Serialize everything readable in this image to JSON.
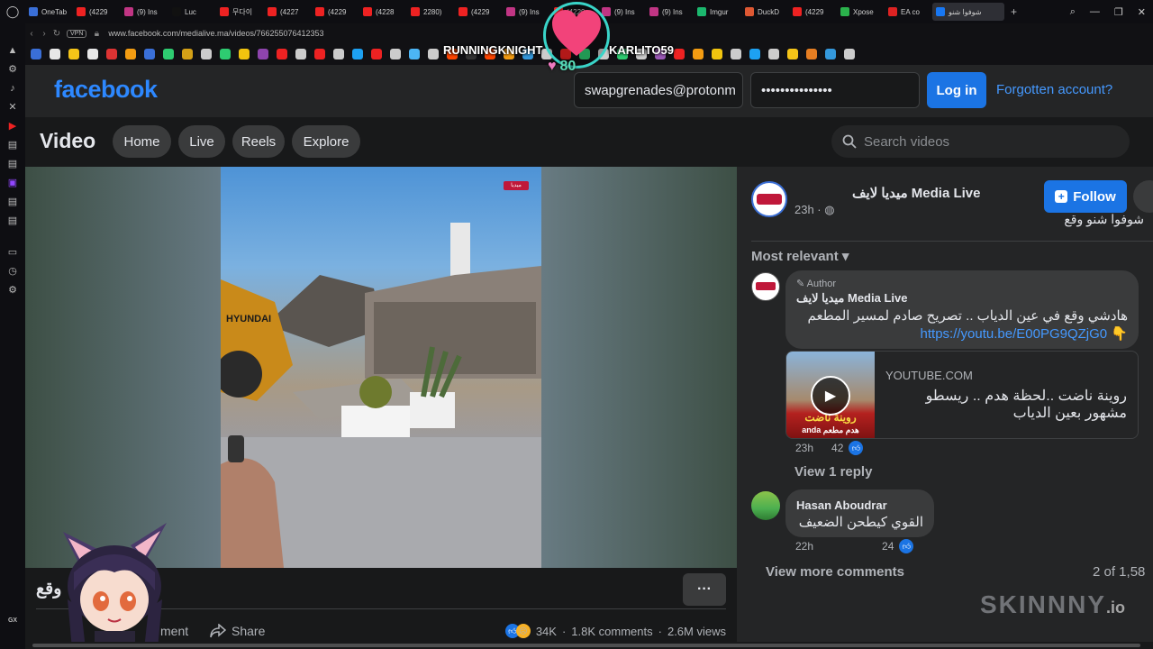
{
  "browser": {
    "tabs": [
      {
        "label": "OneTab",
        "color": "#3a6fd8"
      },
      {
        "label": "(4229",
        "color": "#e22"
      },
      {
        "label": "(9) Ins",
        "color": "#c13584"
      },
      {
        "label": "Luc",
        "color": "#111"
      },
      {
        "label": "무다이",
        "color": "#e22"
      },
      {
        "label": "(4227",
        "color": "#e22"
      },
      {
        "label": "(4229",
        "color": "#e22"
      },
      {
        "label": "(4228",
        "color": "#e22"
      },
      {
        "label": "2280)",
        "color": "#e22"
      },
      {
        "label": "(4229",
        "color": "#e22"
      },
      {
        "label": "(9) Ins",
        "color": "#c13584"
      },
      {
        "label": "(4229",
        "color": "#e22"
      },
      {
        "label": "(9) Ins",
        "color": "#c13584"
      },
      {
        "label": "(9) Ins",
        "color": "#c13584"
      },
      {
        "label": "Imgur",
        "color": "#1bb76e"
      },
      {
        "label": "DuckD",
        "color": "#de5833"
      },
      {
        "label": "(4229",
        "color": "#e22"
      },
      {
        "label": "Xpose",
        "color": "#2bb24c"
      },
      {
        "label": "EA co",
        "color": "#d22"
      },
      {
        "label": "شوفوا شنو",
        "color": "#1877f2",
        "active": true
      }
    ],
    "url": "www.facebook.com/medialive.ma/videos/766255076412353",
    "vpn_label": "VPN",
    "new_tab": "+"
  },
  "bookmark_colors": [
    "#3a6fd8",
    "#e7e7e7",
    "#f5c518",
    "#e7e7e7",
    "#d33",
    "#f39c12",
    "#3a6fd8",
    "#2ecc71",
    "#d4a017",
    "#ccc",
    "#2ecc71",
    "#f1c40f",
    "#8e44ad",
    "#e22",
    "#ccc",
    "#e22",
    "#ccc",
    "#1da1f2",
    "#e22",
    "#ccc",
    "#4cb5f5",
    "#ccc",
    "#ff4500",
    "#333",
    "#ff4500",
    "#f39c12",
    "#3498db",
    "#ccc",
    "#e22",
    "#2ecc71",
    "#ccc",
    "#2ecc71",
    "#ccc",
    "#9b59b6",
    "#e22",
    "#f39c12",
    "#f1c40f",
    "#ccc",
    "#1da1f2",
    "#ccc",
    "#f5c518",
    "#e67e22",
    "#3498db",
    "#ccc"
  ],
  "header": {
    "logo": "facebook",
    "email_value": "swapgrenades@protonm",
    "password_value": "•••••••••••••••",
    "login_label": "Log in",
    "forgot_label": "Forgotten account?"
  },
  "video_nav": {
    "title": "Video",
    "tabs": [
      "Home",
      "Live",
      "Reels",
      "Explore"
    ],
    "search_placeholder": "Search videos"
  },
  "video": {
    "watermark": "ميديا",
    "caption": "وقع",
    "actions": [
      "ment",
      "Share"
    ],
    "reaction_count": "34K",
    "comments": "1.8K comments",
    "views": "2.6M views",
    "separator": "·"
  },
  "post": {
    "page_name": "ميديا لايف Media Live",
    "time": "23h ·",
    "follow_label": "Follow",
    "text": "شوفوا شنو وقع",
    "sort_label": "Most relevant",
    "comments": [
      {
        "author_tag": "Author",
        "name": "ميديا لايف Media Live",
        "text": "هادشي وقع في عين الدياب .. تصريح صادم لمسير المطعم",
        "link": "https://youtu.be/E00PG9QZjG0 👇",
        "time": "23h",
        "likes": "42"
      },
      {
        "name": "Hasan Aboudrar",
        "text": "القوي كيطحن الضعيف",
        "time": "22h",
        "likes": "24"
      }
    ],
    "link_card": {
      "domain": "YOUTUBE.COM",
      "title": "روينة ناضت ..لحظة هدم .. ريسطو مشهور بعين الدياب",
      "thumb_text": "روينة ناضت",
      "thumb_sub": "anda هدم مطعم"
    },
    "view_reply": "View 1 reply",
    "view_more": "View more comments",
    "count": "2 of 1,58"
  },
  "overlays": {
    "left_name": "RUNNINGKNIGHT",
    "right_name": "KARLITO59",
    "heart_count": "80",
    "brand": "SKINNNY",
    "brand_suffix": ".io"
  }
}
